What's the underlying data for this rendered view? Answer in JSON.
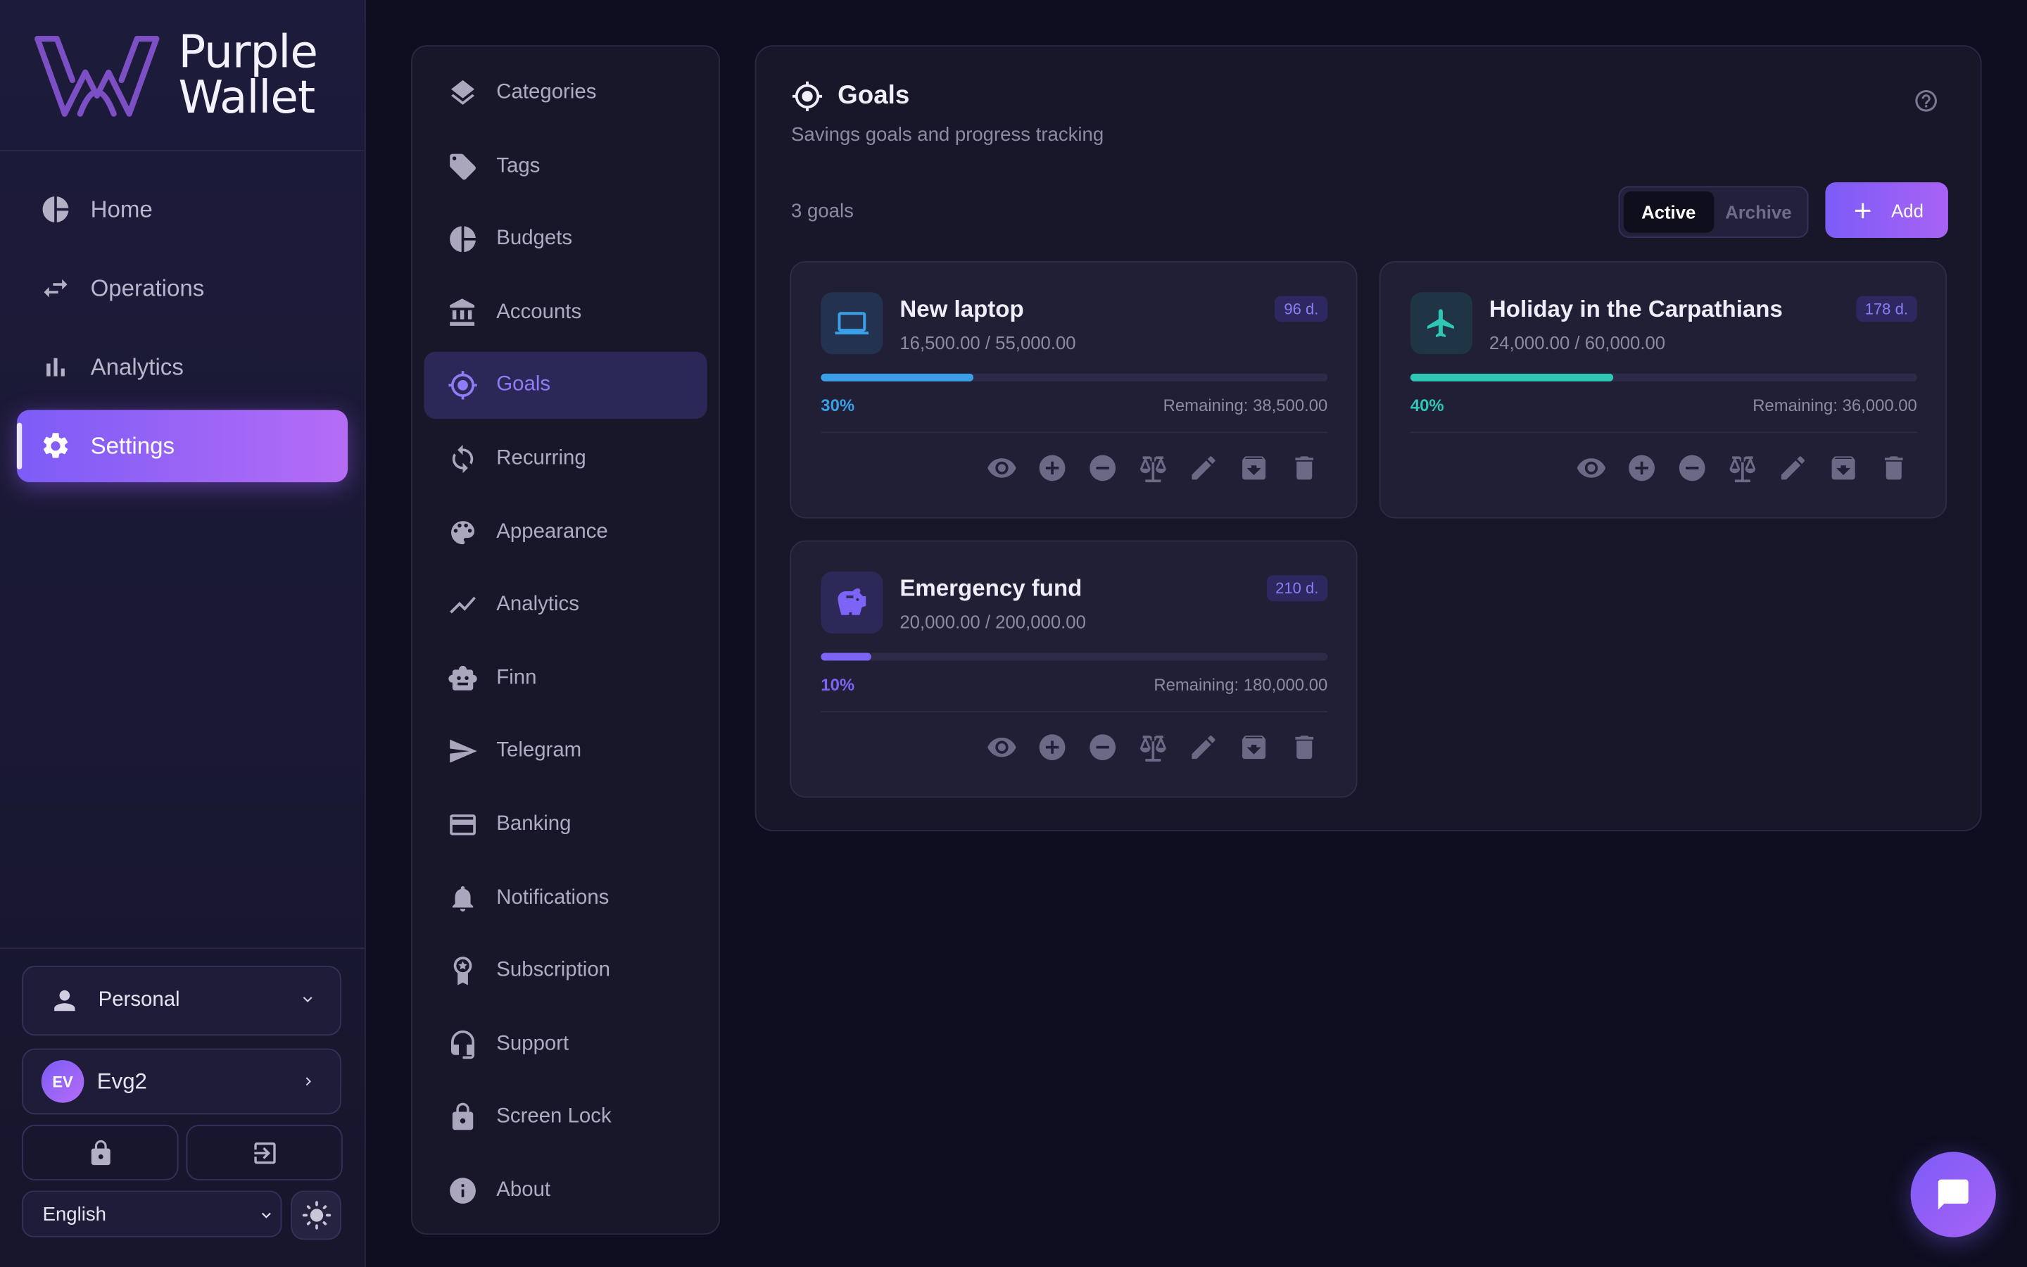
{
  "brand": {
    "line1": "Purple",
    "line2": "Wallet"
  },
  "nav": [
    {
      "label": "Home",
      "icon": "pie-icon"
    },
    {
      "label": "Operations",
      "icon": "transfer-icon"
    },
    {
      "label": "Analytics",
      "icon": "bar-chart-icon"
    },
    {
      "label": "Settings",
      "icon": "gear-icon",
      "active": true
    }
  ],
  "workspace": {
    "label": "Personal"
  },
  "user": {
    "initials": "EV",
    "name": "Evg2"
  },
  "language": {
    "selected": "English"
  },
  "settings_menu": [
    {
      "label": "Categories",
      "icon": "layers-icon"
    },
    {
      "label": "Tags",
      "icon": "tag-icon"
    },
    {
      "label": "Budgets",
      "icon": "pie-icon"
    },
    {
      "label": "Accounts",
      "icon": "bank-icon"
    },
    {
      "label": "Goals",
      "icon": "target-icon",
      "active": true
    },
    {
      "label": "Recurring",
      "icon": "refresh-icon"
    },
    {
      "label": "Appearance",
      "icon": "palette-icon"
    },
    {
      "label": "Analytics",
      "icon": "trend-icon"
    },
    {
      "label": "Finn",
      "icon": "robot-icon"
    },
    {
      "label": "Telegram",
      "icon": "send-icon"
    },
    {
      "label": "Banking",
      "icon": "card-icon"
    },
    {
      "label": "Notifications",
      "icon": "bell-icon"
    },
    {
      "label": "Subscription",
      "icon": "award-icon"
    },
    {
      "label": "Support",
      "icon": "headset-icon"
    },
    {
      "label": "Screen Lock",
      "icon": "lock-icon"
    },
    {
      "label": "About",
      "icon": "info-icon"
    }
  ],
  "goals_panel": {
    "title": "Goals",
    "subtitle": "Savings goals and progress tracking",
    "count": "3 goals",
    "tabs": {
      "active": "Active",
      "archive": "Archive"
    },
    "add_label": "Add"
  },
  "goals": [
    {
      "name": "New laptop",
      "amount": "16,500.00 / 55,000.00",
      "days": "96 d.",
      "percent_label": "30%",
      "progress": 0.3,
      "remaining": "Remaining: 38,500.00",
      "icon": "laptop-icon",
      "color": "#3b9fe8",
      "icon_bg": "#23324f"
    },
    {
      "name": "Holiday in the Carpathians",
      "amount": "24,000.00 / 60,000.00",
      "days": "178 d.",
      "percent_label": "40%",
      "progress": 0.4,
      "remaining": "Remaining: 36,000.00",
      "icon": "plane-icon",
      "color": "#2fc6b6",
      "icon_bg": "#1f3445"
    },
    {
      "name": "Emergency fund",
      "amount": "20,000.00 / 200,000.00",
      "days": "210 d.",
      "percent_label": "10%",
      "progress": 0.1,
      "remaining": "Remaining: 180,000.00",
      "icon": "piggy-bank-icon",
      "color": "#7d63f6",
      "icon_bg": "#2c2858"
    }
  ],
  "colors": {
    "accent": "#7c5cf7",
    "accent2": "#b56cf5",
    "bg": "#0e0e20"
  }
}
